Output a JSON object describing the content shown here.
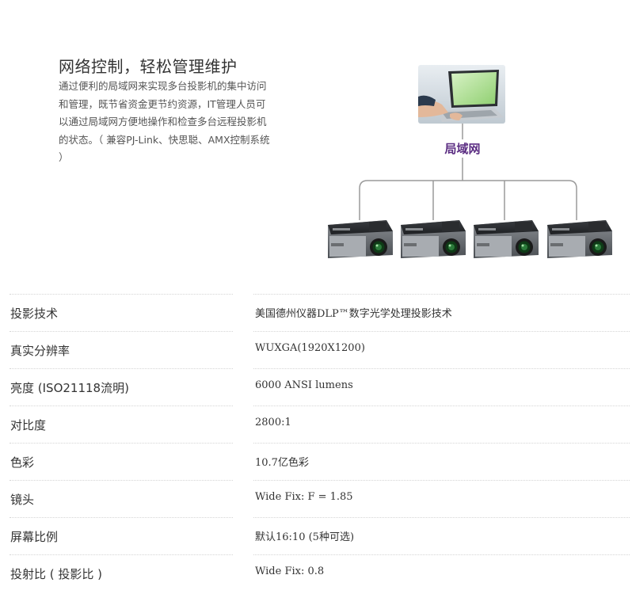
{
  "feature": {
    "title": "网络控制，轻松管理维护",
    "description": "通过便利的局域网来实现多台投影机的集中访问和管理，既节省资金更节约资源，IT管理人员可以通过局域网方便地操作和检查多台远程投影机的状态。（ 兼容PJ-Link、快思聪、AMX控制系统 ）"
  },
  "diagram": {
    "lan_label": "局域网",
    "lan_label_color": "#5b2d82",
    "line_color": "#9a9a9a",
    "hub_icon": "laptop-icon",
    "device_icon": "projector-icon",
    "device_count": 4
  },
  "specs": [
    {
      "label": "投影技术",
      "value": "美国德州仪器DLP™数字光学处理投影技术"
    },
    {
      "label": "真实分辨率",
      "value": "WUXGA(1920X1200)"
    },
    {
      "label": "亮度 (ISO21118流明)",
      "value": "6000 ANSI lumens"
    },
    {
      "label": "对比度",
      "value": "2800:1"
    },
    {
      "label": "色彩",
      "value": "10.7亿色彩"
    },
    {
      "label": "镜头",
      "value": "Wide Fix: F = 1.85"
    },
    {
      "label": "屏幕比例",
      "value": "默认16:10 (5种可选)"
    },
    {
      "label": "投射比 ( 投影比 )",
      "value": "Wide Fix: 0.8"
    }
  ]
}
